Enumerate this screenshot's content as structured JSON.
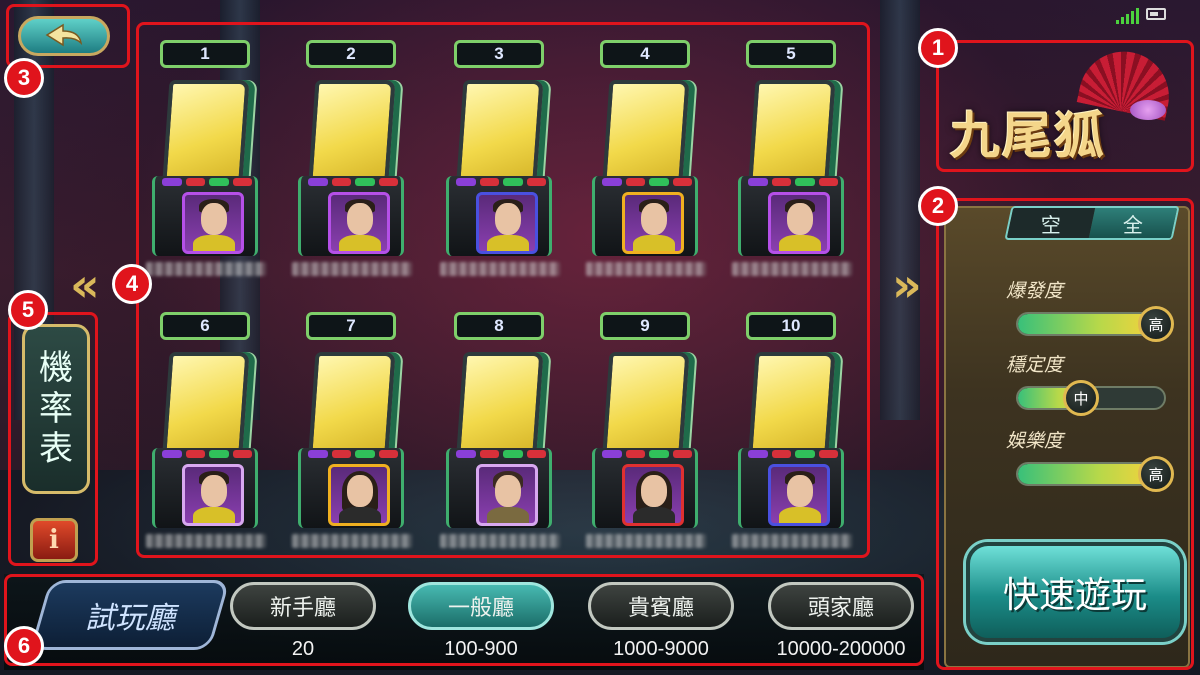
{
  "logo": {
    "title": "九尾狐"
  },
  "annotations": [
    "1",
    "2",
    "3",
    "4",
    "5",
    "6"
  ],
  "machines": [
    {
      "number": "1",
      "frame": "#b550e8",
      "portrait": "male"
    },
    {
      "number": "2",
      "frame": "#b550e8",
      "portrait": "male"
    },
    {
      "number": "3",
      "frame": "#4a50e0",
      "portrait": "male"
    },
    {
      "number": "4",
      "frame": "#f0b020",
      "portrait": "male"
    },
    {
      "number": "5",
      "frame": "#b550e8",
      "portrait": "male"
    },
    {
      "number": "6",
      "frame": "#d8a8f0",
      "portrait": "male"
    },
    {
      "number": "7",
      "frame": "#f0b020",
      "portrait": "female"
    },
    {
      "number": "8",
      "frame": "#d8a8f0",
      "portrait": "warrior"
    },
    {
      "number": "9",
      "frame": "#e03030",
      "portrait": "female"
    },
    {
      "number": "10",
      "frame": "#4a50e0",
      "portrait": "male"
    }
  ],
  "filter_toggle": {
    "empty": "空",
    "full": "全"
  },
  "stats": [
    {
      "label": "爆發度",
      "level": "高",
      "fraction": 1.0
    },
    {
      "label": "穩定度",
      "level": "中",
      "fraction": 0.5
    },
    {
      "label": "娛樂度",
      "level": "高",
      "fraction": 1.0
    }
  ],
  "quick_play": "快速遊玩",
  "odds_table": [
    "機",
    "率",
    "表"
  ],
  "info_icon": "i",
  "trial_room": "試玩廳",
  "rooms": [
    {
      "label": "新手廳",
      "range": "20",
      "active": false
    },
    {
      "label": "一般廳",
      "range": "100-900",
      "active": true
    },
    {
      "label": "貴賓廳",
      "range": "1000-9000",
      "active": false
    },
    {
      "label": "頭家廳",
      "range": "10000-200000",
      "active": false
    }
  ],
  "nav": {
    "prev": "«",
    "next": "»"
  },
  "icons": {
    "back": "back-arrow-icon",
    "signal": "signal-icon",
    "battery": "battery-icon"
  }
}
